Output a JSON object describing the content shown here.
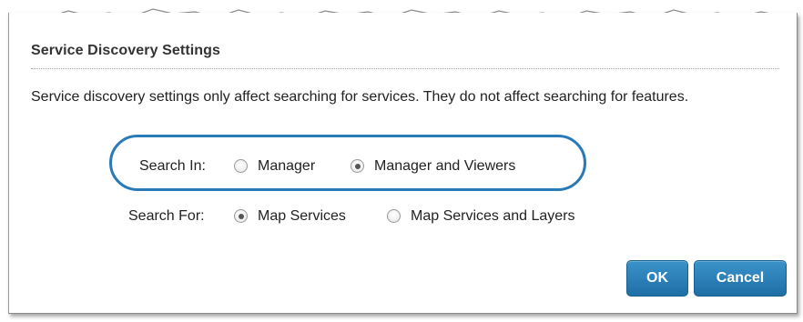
{
  "dialog": {
    "title": "Service Discovery Settings",
    "description": "Service discovery settings only affect searching for services. They do not affect searching for features."
  },
  "search_in": {
    "label": "Search In:",
    "options": [
      {
        "label": "Manager",
        "checked": false
      },
      {
        "label": "Manager and Viewers",
        "checked": true
      }
    ]
  },
  "search_for": {
    "label": "Search For:",
    "options": [
      {
        "label": "Map Services",
        "checked": true
      },
      {
        "label": "Map Services and Layers",
        "checked": false
      }
    ]
  },
  "buttons": {
    "ok_label": "OK",
    "cancel_label": "Cancel"
  },
  "colors": {
    "button_blue": "#2a82bb",
    "highlight_oval": "#2a7ab8"
  }
}
